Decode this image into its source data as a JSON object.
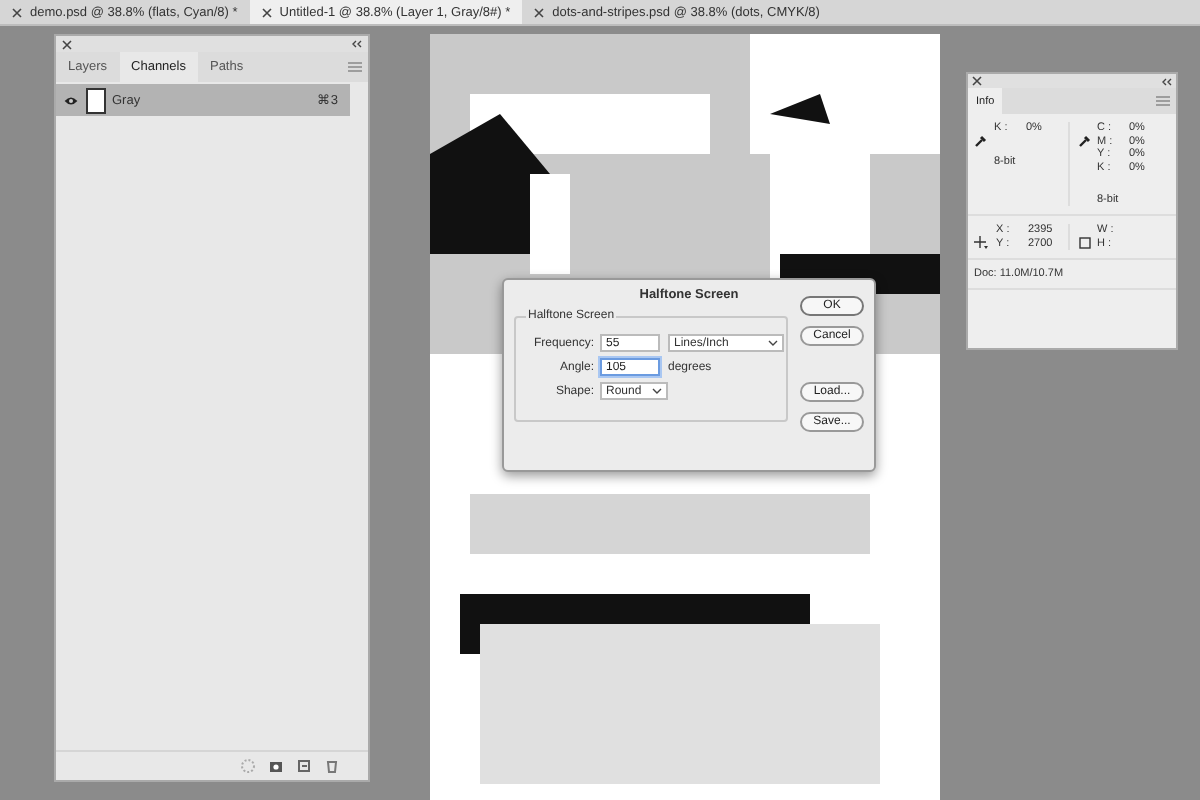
{
  "document_tabs": [
    {
      "label": "demo.psd @ 38.8% (flats, Cyan/8) *",
      "selected": false
    },
    {
      "label": "Untitled-1 @ 38.8% (Layer 1, Gray/8#) *",
      "selected": true
    },
    {
      "label": "dots-and-stripes.psd @ 38.8% (dots, CMYK/8)",
      "selected": false
    }
  ],
  "channels_panel": {
    "tabs": [
      {
        "label": "Layers",
        "selected": false
      },
      {
        "label": "Channels",
        "selected": true
      },
      {
        "label": "Paths",
        "selected": false
      }
    ],
    "channels": [
      {
        "name": "Gray",
        "shortcut": "⌘3",
        "visible": true,
        "selected": true
      }
    ]
  },
  "info_panel": {
    "tab": "Info",
    "left_readout": [
      {
        "label": "K :",
        "value": "0%"
      }
    ],
    "left_depth": "8-bit",
    "right_readout": [
      {
        "label": "C :",
        "value": "0%"
      },
      {
        "label": "M :",
        "value": "0%"
      },
      {
        "label": "Y :",
        "value": "0%"
      },
      {
        "label": "K :",
        "value": "0%"
      }
    ],
    "right_depth": "8-bit",
    "position": [
      {
        "label": "X :",
        "value": "2395"
      },
      {
        "label": "Y :",
        "value": "2700"
      }
    ],
    "size": [
      {
        "label": "W :"
      },
      {
        "label": "H :"
      }
    ],
    "doc": "Doc: 11.0M/10.7M"
  },
  "dialog": {
    "title": "Halftone Screen",
    "group": "Halftone Screen",
    "frequency": {
      "label": "Frequency:",
      "value": "55",
      "unit": "Lines/Inch"
    },
    "angle": {
      "label": "Angle:",
      "value": "105",
      "unit": "degrees"
    },
    "shape": {
      "label": "Shape:",
      "value": "Round"
    },
    "buttons": [
      {
        "label": "OK",
        "default": true
      },
      {
        "label": "Cancel",
        "default": false
      },
      {
        "label": "Load...",
        "default": false
      },
      {
        "label": "Save...",
        "default": false
      }
    ]
  }
}
